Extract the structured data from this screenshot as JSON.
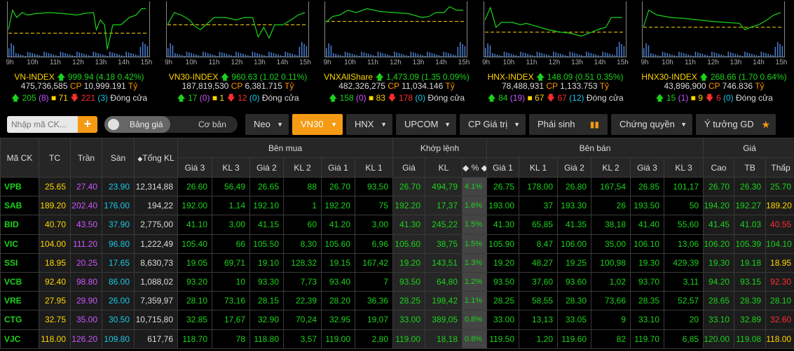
{
  "indices": [
    {
      "name": "VN-INDEX",
      "value": "999.94",
      "change": "(4.18 0.42%)",
      "volume": "475,736,585",
      "cp_label": "CP",
      "cp_value": "10,999.191",
      "unit": "Tỷ",
      "up": "205",
      "ceiling": "(8)",
      "same": "71",
      "down": "221",
      "floor": "(3)",
      "status": "Đóng cửa",
      "series": [
        [
          0,
          0.55
        ],
        [
          0.03,
          0.15
        ],
        [
          0.06,
          0.3
        ],
        [
          0.1,
          0.2
        ],
        [
          0.14,
          0.25
        ],
        [
          0.2,
          0.22
        ],
        [
          0.3,
          0.2
        ],
        [
          0.4,
          0.22
        ],
        [
          0.5,
          0.25
        ],
        [
          0.55,
          0.22
        ],
        [
          0.62,
          0.2
        ],
        [
          0.64,
          0.55
        ],
        [
          0.67,
          0.35
        ],
        [
          0.7,
          0.45
        ],
        [
          0.72,
          0.95
        ],
        [
          0.76,
          0.45
        ],
        [
          0.82,
          0.45
        ],
        [
          0.88,
          0.3
        ],
        [
          0.93,
          0.25
        ],
        [
          0.97,
          0.12
        ],
        [
          1,
          0.12
        ]
      ],
      "ref_level": 0.62
    },
    {
      "name": "VN30-INDEX",
      "value": "960.63",
      "change": "(1.02 0.11%)",
      "volume": "187,819,530",
      "cp_label": "CP",
      "cp_value": "6,381.715",
      "unit": "Tỷ",
      "up": "17",
      "ceiling": "(0)",
      "same": "1",
      "down": "12",
      "floor": "(0)",
      "status": "Đóng cửa",
      "series": [
        [
          0,
          0.45
        ],
        [
          0.05,
          0.2
        ],
        [
          0.1,
          0.25
        ],
        [
          0.16,
          0.35
        ],
        [
          0.2,
          0.48
        ],
        [
          0.24,
          0.55
        ],
        [
          0.28,
          0.45
        ],
        [
          0.34,
          0.3
        ],
        [
          0.42,
          0.3
        ],
        [
          0.5,
          0.35
        ],
        [
          0.56,
          0.3
        ],
        [
          0.62,
          0.3
        ],
        [
          0.66,
          0.7
        ],
        [
          0.7,
          0.5
        ],
        [
          0.74,
          0.72
        ],
        [
          0.78,
          0.45
        ],
        [
          0.84,
          0.45
        ],
        [
          0.9,
          0.35
        ],
        [
          0.95,
          0.25
        ],
        [
          1,
          0.2
        ]
      ],
      "ref_level": 0.45
    },
    {
      "name": "VNXAllShare",
      "value": "1,473.09",
      "change": "(1.35 0.09%)",
      "volume": "482,326,275",
      "cp_label": "CP",
      "cp_value": "11,034.146",
      "unit": "Tỷ",
      "up": "158",
      "ceiling": "(0)",
      "same": "83",
      "down": "178",
      "floor": "(0)",
      "status": "Đóng cửa",
      "series": [
        [
          0,
          0.4
        ],
        [
          0.05,
          0.28
        ],
        [
          0.1,
          0.25
        ],
        [
          0.16,
          0.15
        ],
        [
          0.22,
          0.2
        ],
        [
          0.3,
          0.12
        ],
        [
          0.4,
          0.18
        ],
        [
          0.5,
          0.2
        ],
        [
          0.6,
          0.22
        ],
        [
          0.7,
          0.3
        ],
        [
          0.75,
          0.28
        ],
        [
          0.8,
          0.2
        ],
        [
          0.86,
          0.2
        ],
        [
          0.9,
          0.08
        ],
        [
          0.95,
          0.15
        ],
        [
          1,
          0.15
        ]
      ],
      "ref_level": 0.38
    },
    {
      "name": "HNX-INDEX",
      "value": "148.09",
      "change": "(0.51 0.35%)",
      "volume": "78,488,931",
      "cp_label": "CP",
      "cp_value": "1,133.753",
      "unit": "Tỷ",
      "up": "84",
      "ceiling": "(19)",
      "same": "67",
      "down": "67",
      "floor": "(12)",
      "status": "Đóng cửa",
      "series": [
        [
          0,
          0.35
        ],
        [
          0.04,
          0.1
        ],
        [
          0.08,
          0.5
        ],
        [
          0.12,
          0.4
        ],
        [
          0.2,
          0.4
        ],
        [
          0.26,
          0.45
        ],
        [
          0.3,
          0.42
        ],
        [
          0.4,
          0.5
        ],
        [
          0.46,
          0.55
        ],
        [
          0.55,
          0.6
        ],
        [
          0.62,
          0.62
        ],
        [
          0.7,
          0.68
        ],
        [
          0.76,
          0.62
        ],
        [
          0.82,
          0.55
        ],
        [
          0.88,
          0.5
        ],
        [
          0.92,
          0.3
        ],
        [
          0.96,
          0.3
        ],
        [
          1,
          0.3
        ]
      ],
      "ref_level": 0.6
    },
    {
      "name": "HNX30-INDEX",
      "value": "268.66",
      "change": "(1.70 0.64%)",
      "volume": "43,896,900",
      "cp_label": "CP",
      "cp_value": "746.836",
      "unit": "Tỷ",
      "up": "15",
      "ceiling": "(1)",
      "same": "9",
      "down": "6",
      "floor": "(0)",
      "status": "Đóng cửa",
      "series": [
        [
          0,
          0.5
        ],
        [
          0.04,
          0.15
        ],
        [
          0.1,
          0.25
        ],
        [
          0.2,
          0.3
        ],
        [
          0.3,
          0.32
        ],
        [
          0.4,
          0.35
        ],
        [
          0.5,
          0.38
        ],
        [
          0.6,
          0.4
        ],
        [
          0.7,
          0.42
        ],
        [
          0.74,
          0.55
        ],
        [
          0.78,
          0.5
        ],
        [
          0.84,
          0.45
        ],
        [
          0.9,
          0.35
        ],
        [
          0.95,
          0.25
        ],
        [
          1,
          0.2
        ]
      ],
      "ref_level": 0.5
    }
  ],
  "time_ticks": [
    "9h",
    "10h",
    "11h",
    "12h",
    "13h",
    "14h",
    "15h"
  ],
  "toolbar": {
    "search_placeholder": "Nhập mã CK...",
    "plus": "+",
    "toggle_on": "Bảng giá",
    "toggle_off": "Cơ bản",
    "tabs": [
      "Neo",
      "VN30",
      "HNX",
      "UPCOM",
      "CP Giá trị",
      "Phái sinh",
      "Chứng quyền",
      "Ý tưởng GD"
    ]
  },
  "table": {
    "groups": {
      "symbol": "Mã CK",
      "ref": "TC",
      "ceil": "Trần",
      "floor": "Sàn",
      "total": "Tổng KL",
      "buy": "Bên mua",
      "match": "Khớp lệnh",
      "sell": "Bên bán",
      "price": "Giá"
    },
    "sub": {
      "buy": [
        "Giá 3",
        "KL 3",
        "Giá 2",
        "KL 2",
        "Giá 1",
        "KL 1"
      ],
      "match": [
        "Giá",
        "KL",
        "%"
      ],
      "sell": [
        "Giá 1",
        "KL 1",
        "Giá 2",
        "KL 2",
        "Giá 3",
        "KL 3"
      ],
      "price": [
        "Cao",
        "TB",
        "Thấp"
      ]
    },
    "rows": [
      [
        "VPB",
        "25.65",
        "27.40",
        "23.90",
        "12,314,88",
        "26.60",
        "56,49",
        "26.65",
        "88",
        "26.70",
        "93,50",
        "26.70",
        "494,79",
        "4.1%",
        "26.75",
        "178,00",
        "26.80",
        "167,54",
        "26.85",
        "101,17",
        "26.70",
        "26.30",
        "25.70"
      ],
      [
        "SAB",
        "189.20",
        "202.40",
        "176.00",
        "194,22",
        "192.00",
        "1,14",
        "192.10",
        "1",
        "192.20",
        "75",
        "192.20",
        "17,37",
        "1.6%",
        "193.00",
        "37",
        "193.30",
        "26",
        "193.50",
        "50",
        "194.20",
        "192.27",
        "189.20"
      ],
      [
        "BID",
        "40.70",
        "43.50",
        "37.90",
        "2,775,00",
        "41.10",
        "3,00",
        "41.15",
        "60",
        "41.20",
        "3,00",
        "41.30",
        "245,22",
        "1.5%",
        "41.30",
        "65,85",
        "41.35",
        "38,18",
        "41.40",
        "55,60",
        "41.45",
        "41.03",
        "40.55"
      ],
      [
        "VIC",
        "104.00",
        "111.20",
        "96.80",
        "1,222,49",
        "105.40",
        "66",
        "105.50",
        "8,30",
        "105.60",
        "6,96",
        "105.60",
        "38,75",
        "1.5%",
        "105.90",
        "8,47",
        "106.00",
        "35,00",
        "106.10",
        "13,06",
        "106.20",
        "105.39",
        "104.10"
      ],
      [
        "SSI",
        "18.95",
        "20.25",
        "17.65",
        "8,630,73",
        "19.05",
        "69,71",
        "19.10",
        "128,32",
        "19.15",
        "167,42",
        "19.20",
        "143,51",
        "1.3%",
        "19.20",
        "48,27",
        "19.25",
        "100,98",
        "19.30",
        "429,39",
        "19.30",
        "19.18",
        "18.95"
      ],
      [
        "VCB",
        "92.40",
        "98.80",
        "86.00",
        "1,088,02",
        "93.20",
        "10",
        "93.30",
        "7,73",
        "93.40",
        "7",
        "93.50",
        "64,80",
        "1.2%",
        "93.50",
        "37,60",
        "93.60",
        "1,02",
        "93.70",
        "3,11",
        "94.20",
        "93.15",
        "92.30"
      ],
      [
        "VRE",
        "27.95",
        "29.90",
        "26.00",
        "7,359,97",
        "28.10",
        "73,16",
        "28.15",
        "22,39",
        "28.20",
        "36,36",
        "28.25",
        "198,42",
        "1.1%",
        "28.25",
        "58,55",
        "28.30",
        "73,66",
        "28.35",
        "52,57",
        "28.65",
        "28.39",
        "28.10"
      ],
      [
        "CTG",
        "32.75",
        "35.00",
        "30.50",
        "10,715,80",
        "32.85",
        "17,67",
        "32.90",
        "70,24",
        "32.95",
        "19,07",
        "33.00",
        "389,05",
        "0.8%",
        "33.00",
        "13,13",
        "33.05",
        "9",
        "33.10",
        "20",
        "33.10",
        "32.89",
        "32.60"
      ],
      [
        "VJC",
        "118.00",
        "126.20",
        "109.80",
        "617,76",
        "118.70",
        "78",
        "118.80",
        "3,57",
        "119.00",
        "2,80",
        "119.00",
        "18,18",
        "0.8%",
        "119.50",
        "1,20",
        "119.60",
        "82",
        "119.70",
        "6,85",
        "120.00",
        "119.08",
        "118.00"
      ]
    ],
    "colors": [
      [
        "g",
        "y",
        "p",
        "c",
        "w",
        "g",
        "g",
        "g",
        "g",
        "g",
        "g",
        "g",
        "g",
        "g",
        "g",
        "g",
        "g",
        "g",
        "g",
        "g",
        "g",
        "g",
        "g"
      ],
      [
        "g",
        "y",
        "p",
        "c",
        "w",
        "g",
        "g",
        "g",
        "g",
        "g",
        "g",
        "g",
        "g",
        "g",
        "g",
        "g",
        "g",
        "g",
        "g",
        "g",
        "g",
        "g",
        "y"
      ],
      [
        "g",
        "y",
        "p",
        "c",
        "w",
        "g",
        "g",
        "g",
        "g",
        "g",
        "g",
        "g",
        "g",
        "g",
        "g",
        "g",
        "g",
        "g",
        "g",
        "g",
        "g",
        "g",
        "r"
      ],
      [
        "g",
        "y",
        "p",
        "c",
        "w",
        "g",
        "g",
        "g",
        "g",
        "g",
        "g",
        "g",
        "g",
        "g",
        "g",
        "g",
        "g",
        "g",
        "g",
        "g",
        "g",
        "g",
        "g"
      ],
      [
        "g",
        "y",
        "p",
        "c",
        "w",
        "g",
        "g",
        "g",
        "g",
        "g",
        "g",
        "g",
        "g",
        "g",
        "g",
        "g",
        "g",
        "g",
        "g",
        "g",
        "g",
        "g",
        "y"
      ],
      [
        "g",
        "y",
        "p",
        "c",
        "w",
        "g",
        "g",
        "g",
        "g",
        "g",
        "g",
        "g",
        "g",
        "g",
        "g",
        "g",
        "g",
        "g",
        "g",
        "g",
        "g",
        "g",
        "r"
      ],
      [
        "g",
        "y",
        "p",
        "c",
        "w",
        "g",
        "g",
        "g",
        "g",
        "g",
        "g",
        "g",
        "g",
        "g",
        "g",
        "g",
        "g",
        "g",
        "g",
        "g",
        "g",
        "g",
        "g"
      ],
      [
        "g",
        "y",
        "p",
        "c",
        "w",
        "g",
        "g",
        "g",
        "g",
        "g",
        "g",
        "g",
        "g",
        "g",
        "g",
        "g",
        "g",
        "g",
        "g",
        "g",
        "g",
        "g",
        "r"
      ],
      [
        "g",
        "y",
        "p",
        "c",
        "w",
        "g",
        "g",
        "g",
        "g",
        "g",
        "g",
        "g",
        "g",
        "g",
        "g",
        "g",
        "g",
        "g",
        "g",
        "g",
        "g",
        "g",
        "y"
      ]
    ]
  },
  "colors": {
    "up": "#1bd31b",
    "down": "#ff2e2e",
    "ref": "#ffd600",
    "ceiling": "#cc55ff",
    "floor": "#19c8e6",
    "accent": "#f59a14"
  }
}
